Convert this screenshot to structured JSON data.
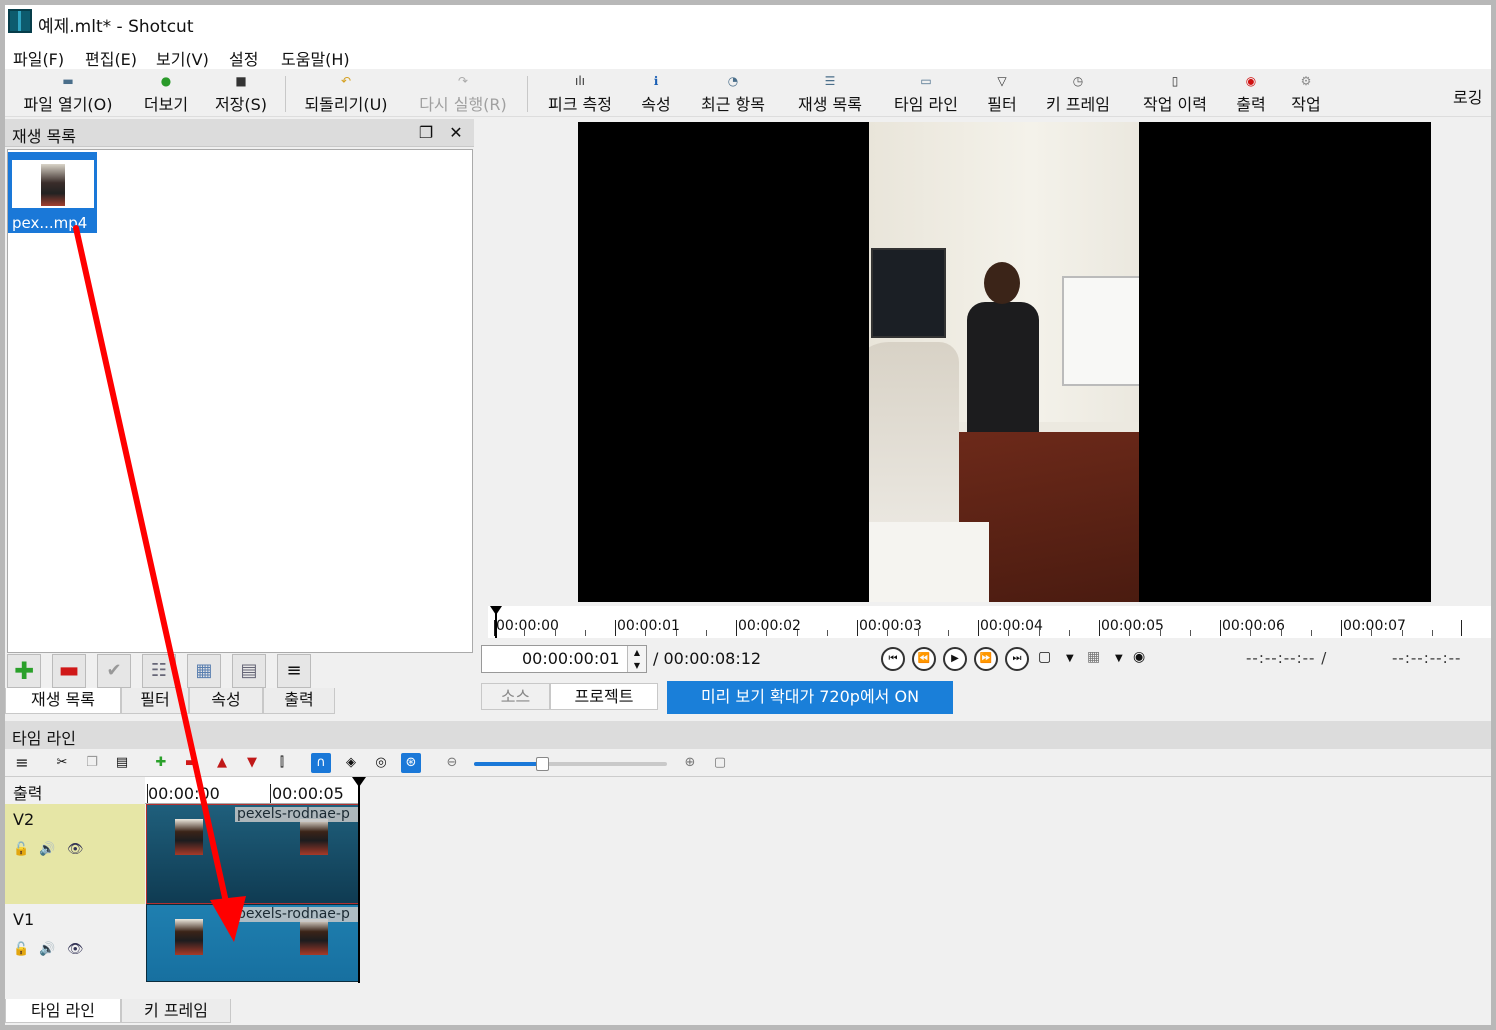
{
  "window": {
    "title": "예제.mlt* - Shotcut"
  },
  "menu": [
    "파일(F)",
    "편집(E)",
    "보기(V)",
    "설정",
    "도움말(H)"
  ],
  "toolbar": {
    "open_file": "파일 열기(O)",
    "more": "더보기",
    "save": "저장(S)",
    "undo": "되돌리기(U)",
    "redo": "다시 실행(R)",
    "peak_meter": "피크 측정",
    "properties": "속성",
    "recent": "최근 항목",
    "playlist": "재생 목록",
    "timeline": "타임 라인",
    "filters": "필터",
    "keyframes": "키 프레임",
    "history": "작업 이력",
    "export": "출력",
    "jobs": "작업",
    "logging": "로깅"
  },
  "playlist": {
    "title": "재생 목록",
    "item_label": "pex...mp4",
    "tabs": [
      "재생 목록",
      "필터",
      "속성",
      "출력"
    ]
  },
  "player": {
    "ruler_labels": [
      "00:00:00",
      "00:00:01",
      "00:00:02",
      "00:00:03",
      "00:00:04",
      "00:00:05",
      "00:00:06",
      "00:00:07"
    ],
    "current_time": "00:00:00:01",
    "duration": "/ 00:00:08:12",
    "in_point": "--:--:--:-- /",
    "out_point": "--:--:--:--",
    "source_tab": "소스",
    "project_tab": "프로젝트",
    "preview_badge": "미리 보기 확대가 720p에서 ON"
  },
  "timeline": {
    "title": "타임 라인",
    "output_label": "출력",
    "ruler_labels": [
      "00:00:00",
      "00:00:05"
    ],
    "tracks": [
      {
        "name": "V2",
        "clip_name": "pexels-rodnae-p"
      },
      {
        "name": "V1",
        "clip_name": "pexels-rodnae-p"
      }
    ],
    "zoom_level": 0.35
  },
  "bottom_tabs": [
    "타임 라인",
    "키 프레임"
  ],
  "colors": {
    "accent": "#1a78d8",
    "annotation_arrow": "#ff0000",
    "v2_header": "#e6e6a6"
  }
}
